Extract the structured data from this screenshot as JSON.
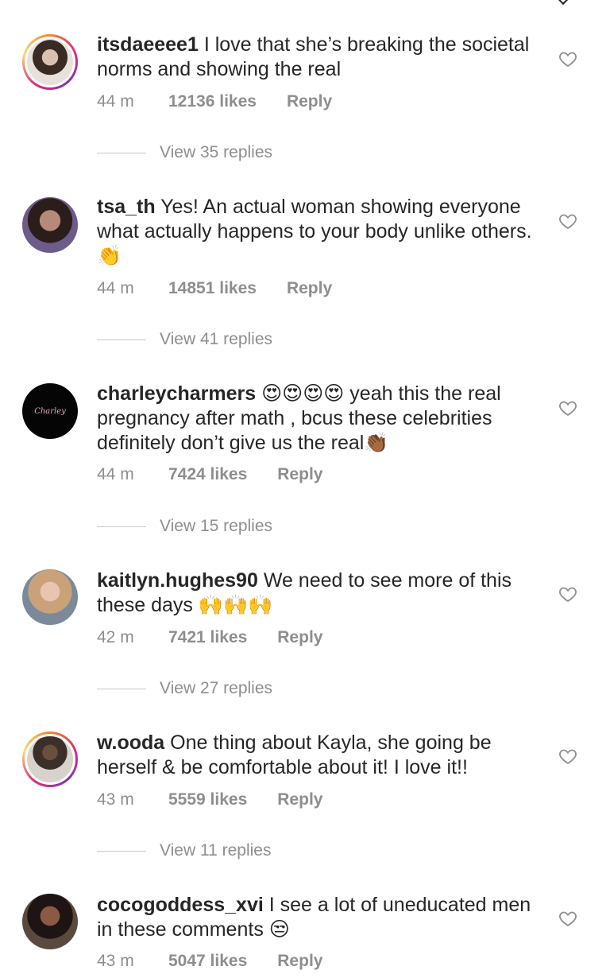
{
  "comments": [
    {
      "username": "itsdaeeee1",
      "text": "I love that she’s breaking the societal norms and showing the real",
      "time": "44 m",
      "likes": "12136 likes",
      "reply": "Reply",
      "view_replies": "View 35 replies",
      "avatar_ring": true
    },
    {
      "username": "tsa_th",
      "text": "Yes! An actual woman showing everyone what actually happens to your body unlike others. 👏",
      "time": "44 m",
      "likes": "14851 likes",
      "reply": "Reply",
      "view_replies": "View 41 replies",
      "avatar_ring": false
    },
    {
      "username": "charleycharmers",
      "text": "😍😍😍😍 yeah this the real pregnancy after math , bcus these celebrities definitely don’t give us the real👏🏾",
      "time": "44 m",
      "likes": "7424 likes",
      "reply": "Reply",
      "view_replies": "View 15 replies",
      "avatar_ring": false
    },
    {
      "username": "kaitlyn.hughes90",
      "text": "We need to see more of this these days 🙌🙌🙌",
      "time": "42 m",
      "likes": "7421 likes",
      "reply": "Reply",
      "view_replies": "View 27 replies",
      "avatar_ring": false
    },
    {
      "username": "w.ooda",
      "text": "One thing about Kayla, she going be herself & be comfortable about it! I love it!!",
      "time": "43 m",
      "likes": "5559 likes",
      "reply": "Reply",
      "view_replies": "View 11 replies",
      "avatar_ring": true
    },
    {
      "username": "cocogoddess_xvi",
      "text": "I see a lot of uneducated men in these comments 😒",
      "time": "43 m",
      "likes": "5047 likes",
      "reply": "Reply",
      "avatar_ring": false
    }
  ],
  "icons": {
    "like": "heart-outline-icon"
  },
  "colors": {
    "text": "#262626",
    "secondary": "#8e8e8e"
  }
}
